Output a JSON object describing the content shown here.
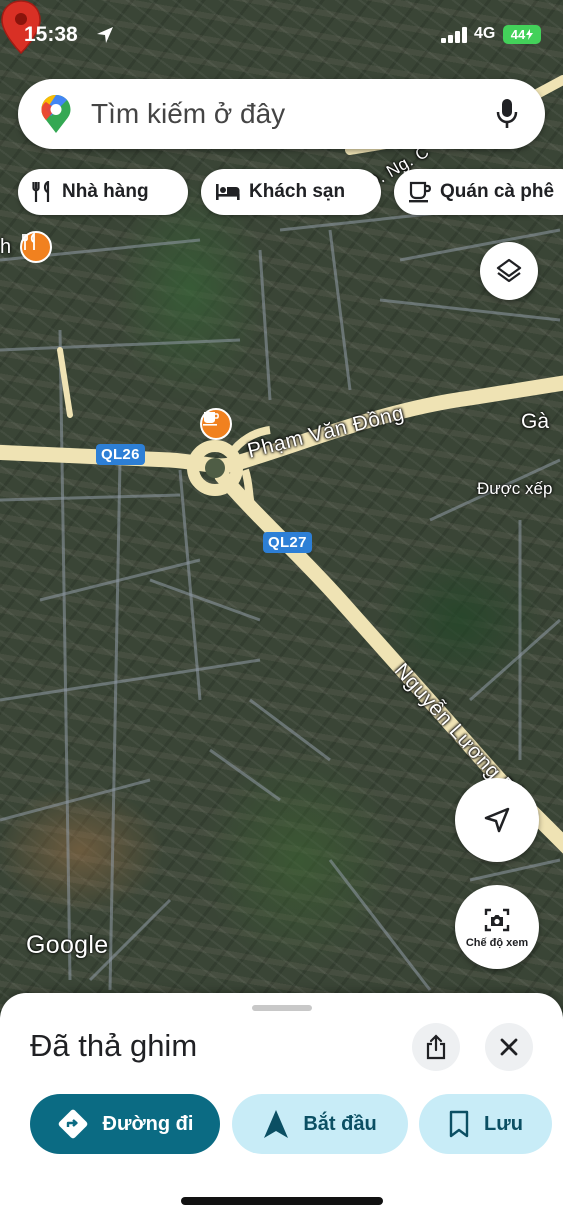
{
  "status_bar": {
    "time": "15:38",
    "network": "4G",
    "battery": "44"
  },
  "search": {
    "placeholder": "Tìm kiếm ở đây"
  },
  "chips": [
    {
      "label": "Nhà hàng",
      "icon": "restaurant-icon"
    },
    {
      "label": "Khách sạn",
      "icon": "hotel-icon"
    },
    {
      "label": "Quán cà phê",
      "icon": "coffee-icon"
    }
  ],
  "map": {
    "road_shields": [
      "QL26",
      "QL27"
    ],
    "street_labels": [
      "Phạm Văn Đồng",
      "Nguyễn Lương Bằng",
      "Đ. Ng. C"
    ],
    "place_labels": [
      "Gà",
      "Được xếp"
    ],
    "edge_label": "h",
    "attribution": "Google",
    "pin_color": "#d93025",
    "poi_color": "#f1811f"
  },
  "controls": {
    "view_mode_label": "Chế độ xem"
  },
  "sheet": {
    "title": "Đã thả ghim",
    "actions": [
      {
        "label": "Đường đi",
        "icon": "directions-icon"
      },
      {
        "label": "Bắt đầu",
        "icon": "navigation-arrow-icon"
      },
      {
        "label": "Lưu",
        "icon": "bookmark-icon"
      }
    ]
  },
  "colors": {
    "primary_action": "#0b6b83",
    "secondary_action": "#c8ecf7",
    "road": "#efe3b4",
    "road_shield": "#2d7fd6"
  }
}
